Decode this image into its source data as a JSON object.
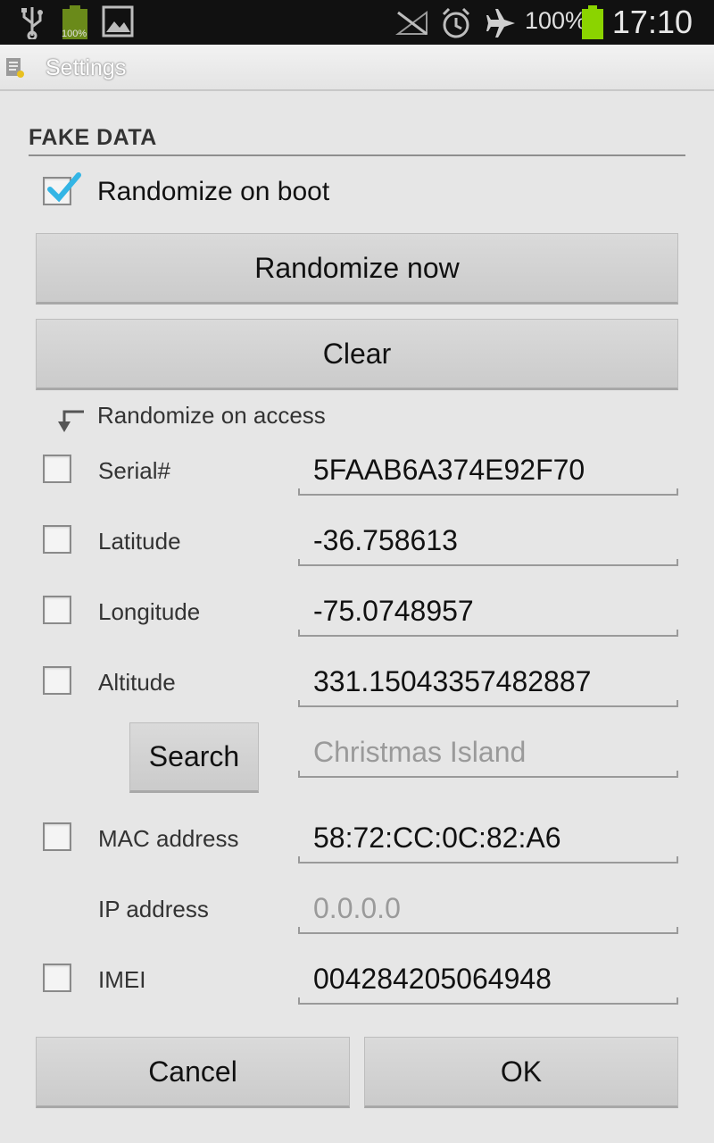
{
  "status_bar": {
    "battery_small_label": "100%",
    "battery_percent": "100%",
    "time": "17:10",
    "icons": [
      "usb-icon",
      "battery-icon",
      "image-icon",
      "no-signal-icon",
      "alarm-icon",
      "airplane-icon",
      "battery-charging-icon"
    ]
  },
  "titlebar": {
    "title": "Settings",
    "icon": "settings-app-icon"
  },
  "section": {
    "header": "FAKE DATA"
  },
  "randomize_on_boot": {
    "label": "Randomize on boot",
    "checked": true
  },
  "buttons": {
    "randomize_now": "Randomize now",
    "clear": "Clear",
    "search": "Search",
    "cancel": "Cancel",
    "ok": "OK"
  },
  "randomize_on_access": {
    "label": "Randomize on access"
  },
  "fields": {
    "serial": {
      "label": "Serial#",
      "value": "5FAAB6A374E92F70",
      "checked": false
    },
    "latitude": {
      "label": "Latitude",
      "value": "-36.758613",
      "checked": false
    },
    "longitude": {
      "label": "Longitude",
      "value": "-75.0748957",
      "checked": false
    },
    "altitude": {
      "label": "Altitude",
      "value": "331.15043357482887",
      "checked": false
    },
    "search_location": {
      "placeholder": "Christmas Island"
    },
    "mac": {
      "label": "MAC address",
      "value": "58:72:CC:0C:82:A6",
      "checked": false
    },
    "ip": {
      "label": "IP address",
      "placeholder": "0.0.0.0"
    },
    "imei": {
      "label": "IMEI",
      "value": "004284205064948",
      "checked": false
    }
  },
  "colors": {
    "check_accent": "#33b5e5",
    "background": "#e6e6e6",
    "battery_green": "#8bd400"
  }
}
